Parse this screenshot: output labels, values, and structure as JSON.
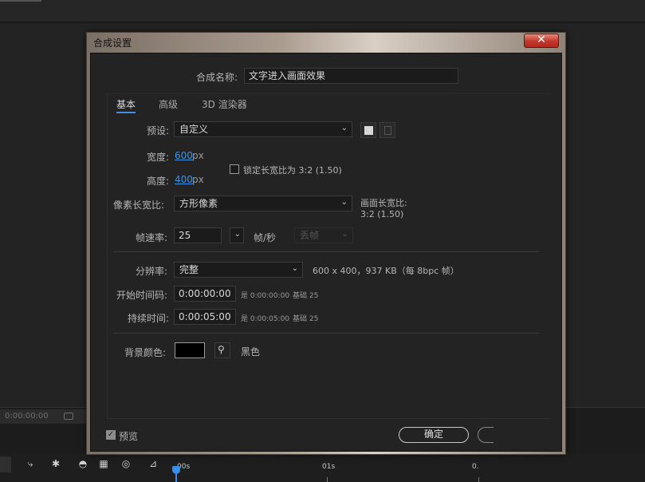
{
  "dialog": {
    "title": "合成设置",
    "close_label": "✕",
    "comp_name_label": "合成名称:",
    "comp_name_value": "文字进入画面效果",
    "tabs": [
      {
        "label": "基本",
        "active": true
      },
      {
        "label": "高级",
        "active": false
      },
      {
        "label": "3D 渲染器",
        "active": false
      }
    ],
    "preset": {
      "label": "预设:",
      "value": "自定义"
    },
    "width": {
      "label": "宽度:",
      "value": "600",
      "unit": "px"
    },
    "height": {
      "label": "高度:",
      "value": "400",
      "unit": "px"
    },
    "lock_aspect": {
      "label": "锁定长宽比为 3:2 (1.50)",
      "checked": false
    },
    "pixel_aspect": {
      "label": "像素长宽比:",
      "value": "方形像素"
    },
    "frame_aspect": {
      "label": "画面长宽比:",
      "value": "3:2 (1.50)"
    },
    "frame_rate": {
      "label": "帧速率:",
      "value": "25",
      "unit": "帧/秒",
      "drop_frame": "丢帧"
    },
    "resolution": {
      "label": "分辨率:",
      "value": "完整",
      "info": "600 x 400，937 KB（每 8bpc 帧）"
    },
    "start_timecode": {
      "label": "开始时间码:",
      "value": "0:00:00:00",
      "is_text": "是 0:00:00:00",
      "base_text": "基础 25"
    },
    "duration": {
      "label": "持续时间:",
      "value": "0:00:05:00",
      "is_text": "是 0:00:05:00",
      "base_text": "基础 25"
    },
    "bg_color": {
      "label": "背景颜色:",
      "name": "黑色",
      "color": "#000000"
    },
    "preview": {
      "label": "预览",
      "checked": true
    },
    "ok_label": "确定"
  },
  "background": {
    "timecode": "0:00:00:00",
    "ruler_labels": [
      "00s",
      "01s",
      "0."
    ]
  },
  "colors": {
    "accent": "#3f93e6",
    "close": "#c0392b"
  }
}
